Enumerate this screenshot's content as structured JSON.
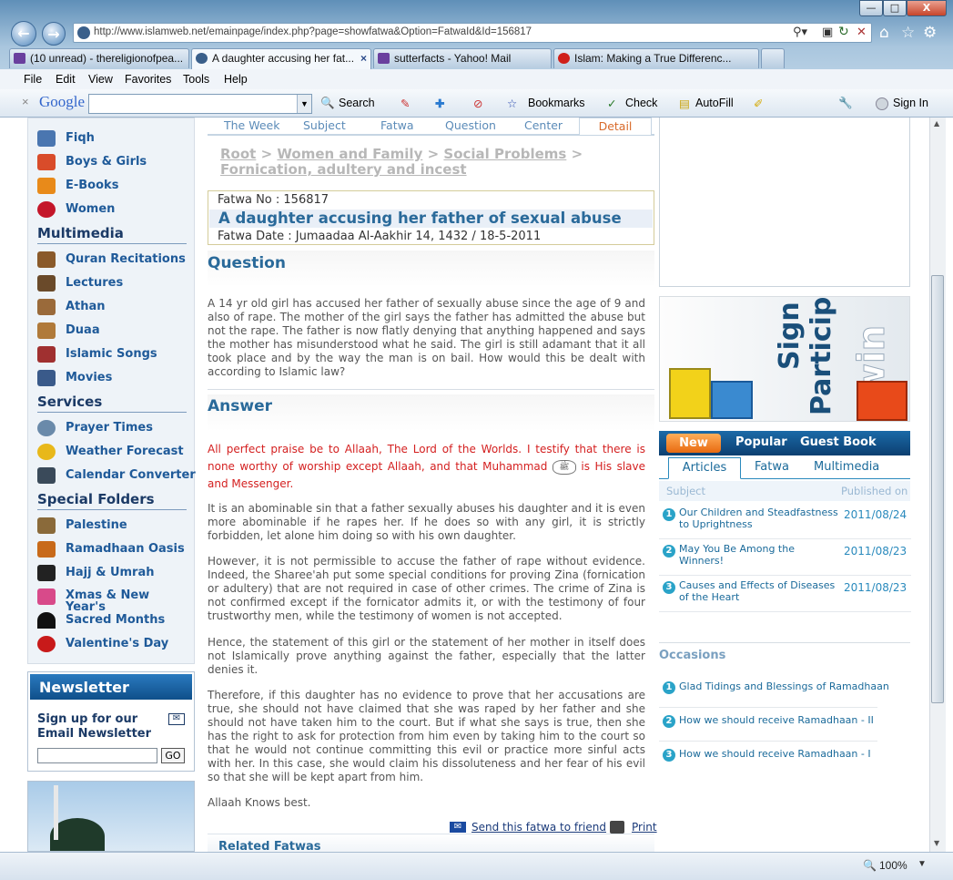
{
  "window": {
    "minimize": "—",
    "maximize": "□",
    "close": "X"
  },
  "address": {
    "url": "http://www.islamweb.net/emainpage/index.php?page=showfatwa&Option=FatwaId&Id=156817"
  },
  "tabs": [
    {
      "label": "(10 unread) - thereligionofpea..."
    },
    {
      "label": "A daughter accusing her fat..."
    },
    {
      "label": "sutterfacts - Yahoo! Mail"
    },
    {
      "label": "Islam: Making a True Differenc..."
    }
  ],
  "menu": [
    "File",
    "Edit",
    "View",
    "Favorites",
    "Tools",
    "Help"
  ],
  "google_toolbar": {
    "search": "Search",
    "bookmarks": "Bookmarks",
    "check": "Check",
    "autofill": "AutoFill",
    "signin": "Sign In",
    "logo": "Google"
  },
  "sidebar": {
    "items_top": [
      {
        "label": "Fiqh",
        "color": "#4a76b0"
      },
      {
        "label": "Boys & Girls",
        "color": "#d94c2a"
      },
      {
        "label": "E-Books",
        "color": "#e88a1a"
      },
      {
        "label": "Women",
        "color": "#c4162a"
      }
    ],
    "multimedia_title": "Multimedia",
    "multimedia": [
      {
        "label": "Quran Recitations",
        "color": "#8a5a2a"
      },
      {
        "label": "Lectures",
        "color": "#6a4a2a"
      },
      {
        "label": "Athan",
        "color": "#9a6a3a"
      },
      {
        "label": "Duaa",
        "color": "#b07a3a"
      },
      {
        "label": "Islamic Songs",
        "color": "#a03030"
      },
      {
        "label": "Movies",
        "color": "#3a5a8a"
      }
    ],
    "services_title": "Services",
    "services": [
      {
        "label": "Prayer Times",
        "color": "#6a8aaa"
      },
      {
        "label": "Weather Forecast",
        "color": "#e8b81a"
      },
      {
        "label": "Calendar Converter",
        "color": "#3a4a5a"
      }
    ],
    "special_title": "Special Folders",
    "special": [
      {
        "label": "Palestine",
        "color": "#8a6a3a"
      },
      {
        "label": "Ramadhaan Oasis",
        "color": "#c86a1a"
      },
      {
        "label": "Hajj & Umrah",
        "color": "#222222"
      },
      {
        "label": "Xmas & New Year's",
        "color": "#d84a8a"
      },
      {
        "label": "Sacred Months",
        "color": "#111111"
      },
      {
        "label": "Valentine's Day",
        "color": "#c81a1a"
      }
    ]
  },
  "newsletter": {
    "title": "Newsletter",
    "signup": "Sign up for our Email Newsletter",
    "go": "GO"
  },
  "fatwa": {
    "tabs": [
      "The Week",
      "Subject",
      "Fatwa",
      "Question",
      "Center",
      "Detail"
    ],
    "breadcrumb": {
      "root": "Root",
      "sep": ">",
      "cat": "Women and Family",
      "sub": "Social Problems",
      "leaf": "Fornication, adultery and incest"
    },
    "number": "Fatwa No : 156817",
    "title": "A daughter accusing her father of sexual abuse",
    "date": "Fatwa Date : Jumaadaa Al-Aakhir 14, 1432 / 18-5-2011",
    "question_heading": "Question",
    "question": "A 14 yr old girl has accused her father of sexually abuse since the age of 9 and also of rape. The mother of the girl says the father has admitted the abuse but not the rape. The father is now flatly denying that anything happened and says the mother has misunderstood what he said. The girl is still adamant that it all took place and by the way the man is on bail. How would this be dealt with according to Islamic law?",
    "answer_heading": "Answer",
    "praise_a": "All perfect praise be to Allaah, The Lord of the Worlds. I testify that there is none worthy of worship except Allaah, and that Muhammad",
    "praise_b": "is His slave and Messenger.",
    "p1": "It is an abominable sin that a father sexually abuses his daughter and it is even more abominable if he rapes her. If he does so with any girl, it is strictly forbidden, let alone him doing so with his own daughter.",
    "p2": "However, it is not permissible to accuse the father of rape without evidence. Indeed, the Sharee'ah put some special conditions for proving Zina (fornication or adultery) that are not required in case of other crimes. The crime of Zina is not confirmed except if the fornicator admits it, or with the testimony of four trustworthy men, while the testimony of women is not accepted.",
    "p3": "Hence, the statement of this girl or the statement of her mother in itself does not Islamically prove anything against the father, especially that the latter denies it.",
    "p4": "Therefore, if this daughter has no evidence to prove that her accusations are true, she should not have claimed that she was raped by her father and she should not have taken him to the court. But if what she says is true, then she has the right to ask for protection from him even by taking him to the court so that he would not continue committing this evil or practice more sinful acts with her. In this case, she would claim his dissoluteness and her fear of his evil so that she will be kept apart from him.",
    "closing": "Allaah Knows best.",
    "send": "Send this fatwa to friend",
    "print": "Print",
    "related": "Related Fatwas"
  },
  "right": {
    "banner_line1": "Sign up",
    "banner_line2": "Participate",
    "banner_line3": "win",
    "tabs_top": [
      "New",
      "Popular",
      "Guest Book"
    ],
    "tabs_sub": [
      "Articles",
      "Fatwa",
      "Multimedia"
    ],
    "col_subject": "Subject",
    "col_published": "Published on",
    "articles": [
      {
        "n": "1",
        "title": "Our Children and Steadfastness to Uprightness",
        "date": "2011/08/24"
      },
      {
        "n": "2",
        "title": "May You Be Among the Winners!",
        "date": "2011/08/23"
      },
      {
        "n": "3",
        "title": "Causes and Effects of Diseases of the Heart",
        "date": "2011/08/23"
      }
    ],
    "occasions_title": "Occasions",
    "occasions": [
      {
        "n": "1",
        "title": "Glad Tidings and Blessings of Ramadhaan"
      },
      {
        "n": "2",
        "title": "How we should receive Ramadhaan - II"
      },
      {
        "n": "3",
        "title": "How we should receive Ramadhaan - I"
      }
    ]
  },
  "status": {
    "zoom": "100%"
  }
}
